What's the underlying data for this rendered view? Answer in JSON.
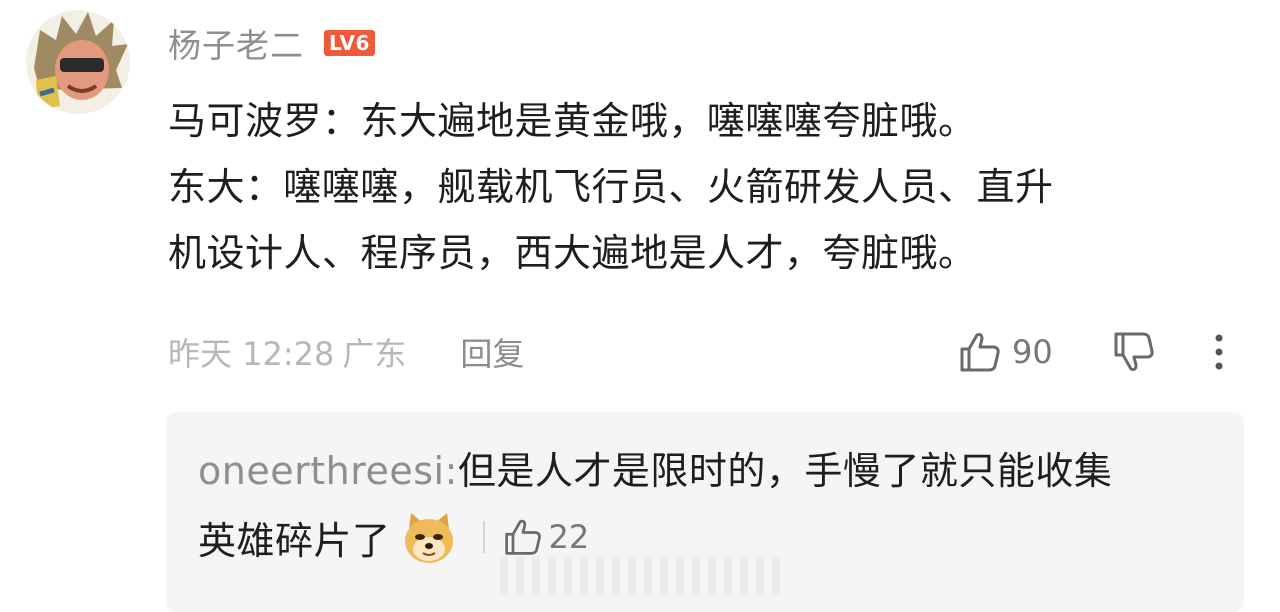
{
  "comment": {
    "username": "杨子老二",
    "level_badge": "LV6",
    "text": "马可波罗：东大遍地是黄金哦，噻噻噻夸脏哦。\n东大：噻噻噻，舰载机飞行员、火箭研发人员、直升\n机设计人、程序员，西大遍地是人才，夸脏哦。",
    "time": "昨天 12:28",
    "region": "广东",
    "reply_label": "回复",
    "like_count": "90",
    "icons": {
      "like": "thumbs-up-icon",
      "dislike": "thumbs-down-icon",
      "more": "more-vertical-icon"
    }
  },
  "reply": {
    "author": "oneerthreesi:",
    "text_line1": "但是人才是限时的，手慢了就只能收集",
    "text_line2": "英雄碎片了",
    "emoji": "doge-emoji",
    "like_count": "22"
  },
  "colors": {
    "badge": "#ef5a3a",
    "muted_text": "#8e8e8e",
    "card_bg": "#f5f5f5"
  }
}
